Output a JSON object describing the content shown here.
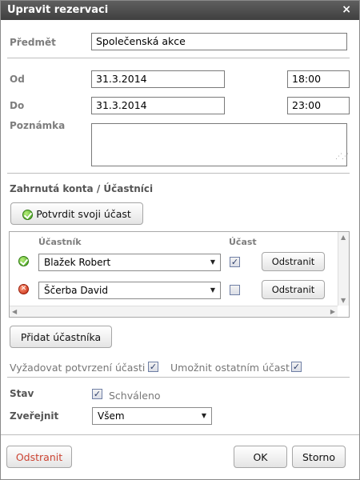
{
  "dialog": {
    "title": "Upravit rezervaci",
    "close_symbol": "×"
  },
  "subject": {
    "label": "Předmět",
    "value": "Společenská akce"
  },
  "from": {
    "label": "Od",
    "date": "31.3.2014",
    "time": "18:00"
  },
  "to": {
    "label": "Do",
    "date": "31.3.2014",
    "time": "23:00"
  },
  "note": {
    "label": "Poznámka",
    "value": ""
  },
  "accounts": {
    "title": "Zahrnutá konta / Účastníci",
    "confirm_button": "Potvrdit svoji účast",
    "col_participant": "Účastník",
    "col_attendance": "Účast",
    "rows": [
      {
        "status_icon": "ok-icon",
        "name": "Blažek Robert",
        "attending": true,
        "remove_label": "Odstranit"
      },
      {
        "status_icon": "declined-icon",
        "name": "Ščerba David",
        "attending": false,
        "remove_label": "Odstranit"
      }
    ],
    "add_button": "Přidat účastníka"
  },
  "options": {
    "require_confirmation_label": "Vyžadovat potvrzení účasti",
    "require_confirmation_checked": true,
    "allow_others_label": "Umožnit ostatním účast",
    "allow_others_checked": true
  },
  "status": {
    "label": "Stav",
    "approved_label": "Schváleno",
    "approved_checked": true
  },
  "publish": {
    "label": "Zveřejnit",
    "value": "Všem"
  },
  "footer": {
    "delete_label": "Odstranit",
    "ok_label": "OK",
    "cancel_label": "Storno"
  },
  "colors": {
    "titlebar": "#4a4a4a",
    "delete_text": "#cc4433",
    "label_gray": "#7d7d7d"
  }
}
